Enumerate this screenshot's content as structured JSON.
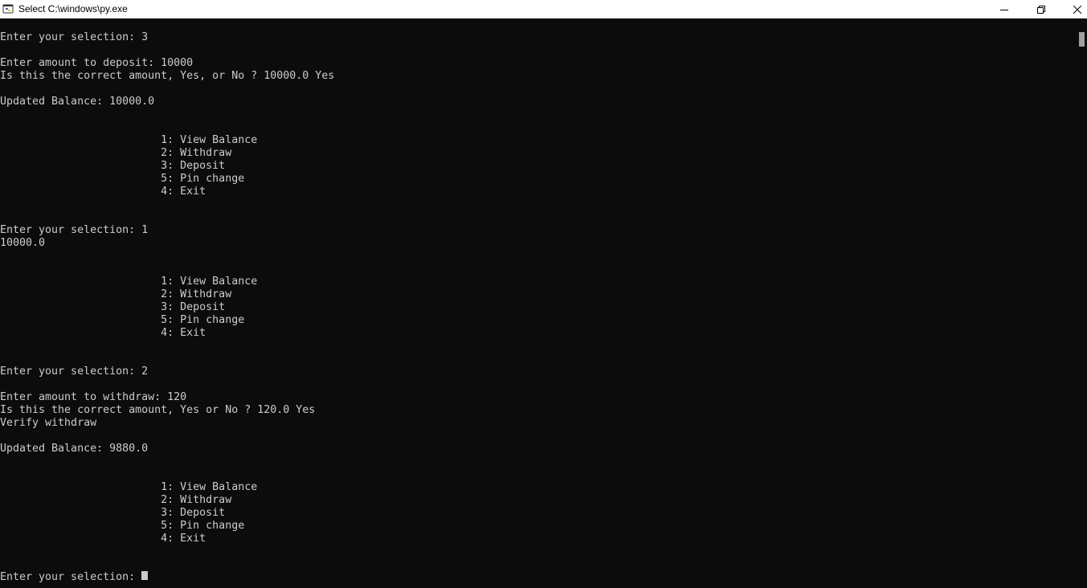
{
  "window": {
    "title": "Select C:\\windows\\py.exe",
    "icon": "python-icon"
  },
  "controls": [
    "minimize-icon",
    "restore-icon",
    "close-icon"
  ],
  "console": {
    "lines": [
      "Enter your selection: 3",
      "",
      "Enter amount to deposit: 10000",
      "Is this the correct amount, Yes, or No ? 10000.0 Yes",
      "",
      "Updated Balance: 10000.0",
      "",
      "",
      "                         1: View Balance",
      "                         2: Withdraw",
      "                         3: Deposit",
      "                         5: Pin change",
      "                         4: Exit",
      "",
      "",
      "Enter your selection: 1",
      "10000.0",
      "",
      "",
      "                         1: View Balance",
      "                         2: Withdraw",
      "                         3: Deposit",
      "                         5: Pin change",
      "                         4: Exit",
      "",
      "",
      "Enter your selection: 2",
      "",
      "Enter amount to withdraw: 120",
      "Is this the correct amount, Yes or No ? 120.0 Yes",
      "Verify withdraw",
      "",
      "Updated Balance: 9880.0",
      "",
      "",
      "                         1: View Balance",
      "                         2: Withdraw",
      "                         3: Deposit",
      "                         5: Pin change",
      "                         4: Exit",
      "",
      "",
      "Enter your selection: "
    ]
  },
  "colors": {
    "background": "#0c0c0c",
    "foreground": "#cccccc",
    "titlebar": "#ffffff"
  }
}
